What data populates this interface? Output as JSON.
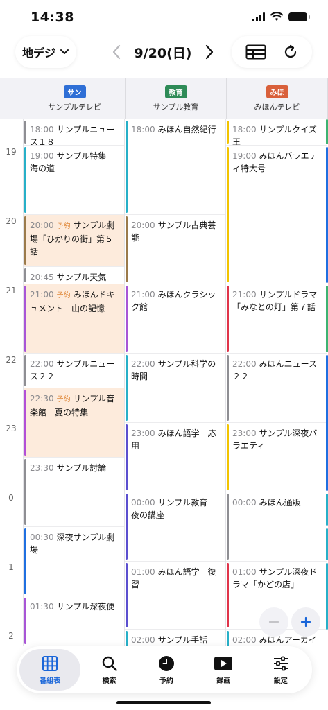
{
  "status_bar": {
    "time": "14:38"
  },
  "toolbar": {
    "channel_type": "地デジ",
    "date": "9/20(日)"
  },
  "channels": [
    {
      "badge": "サン",
      "badge_color": "#2f6fd6",
      "name": "サンプルテレビ"
    },
    {
      "badge": "教育",
      "badge_color": "#2e8b57",
      "name": "サンプル教育"
    },
    {
      "badge": "みほ",
      "badge_color": "#d9603b",
      "name": "みほんテレビ"
    }
  ],
  "hours": [
    "19",
    "20",
    "21",
    "22",
    "23",
    "0",
    "1",
    "2"
  ],
  "reserved_label": "予約",
  "programs": {
    "col1": [
      {
        "time": "18:00",
        "title": "サンプルニュース１８"
      },
      {
        "time": "19:00",
        "title": "サンプル特集　海の道"
      },
      {
        "time": "20:00",
        "title": "サンプル劇場「ひかりの街」第５話"
      },
      {
        "time": "20:45",
        "title": "サンプル天気"
      },
      {
        "time": "21:00",
        "title": "みほんドキュメント　山の記憶"
      },
      {
        "time": "22:00",
        "title": "サンプルニュース２２"
      },
      {
        "time": "22:30",
        "title": "サンプル音楽館　夏の特集"
      },
      {
        "time": "23:30",
        "title": "サンプル討論"
      },
      {
        "time": "00:30",
        "title": "深夜サンプル劇場"
      },
      {
        "time": "01:30",
        "title": "サンプル深夜便"
      }
    ],
    "col2": [
      {
        "time": "18:00",
        "title": "みほん自然紀行"
      },
      {
        "time": "20:00",
        "title": "サンプル古典芸能"
      },
      {
        "time": "21:00",
        "title": "みほんクラシック館"
      },
      {
        "time": "22:00",
        "title": "サンプル科学の時間"
      },
      {
        "time": "23:00",
        "title": "みほん語学　応用"
      },
      {
        "time": "00:00",
        "title": "サンプル教育　夜の講座"
      },
      {
        "time": "01:00",
        "title": "みほん語学　復習"
      },
      {
        "time": "02:00",
        "title": "サンプル手話"
      }
    ],
    "col3": [
      {
        "time": "18:00",
        "title": "サンプルクイズ王"
      },
      {
        "time": "19:00",
        "title": "みほんバラエティ特大号"
      },
      {
        "time": "21:00",
        "title": "サンプルドラマ「みなとの灯」第７話"
      },
      {
        "time": "22:00",
        "title": "みほんニュース２２"
      },
      {
        "time": "23:00",
        "title": "サンプル深夜バラエティ"
      },
      {
        "time": "00:00",
        "title": "みほん通販"
      },
      {
        "time": "01:00",
        "title": "サンプル深夜ドラマ「かどの店」"
      },
      {
        "time": "02:00",
        "title": "みほんアーカイブ"
      }
    ]
  },
  "tabs": [
    {
      "label": "番組表",
      "icon": "grid-icon"
    },
    {
      "label": "検索",
      "icon": "search-icon"
    },
    {
      "label": "予約",
      "icon": "clock-icon"
    },
    {
      "label": "録画",
      "icon": "play-icon"
    },
    {
      "label": "設定",
      "icon": "sliders-icon"
    }
  ]
}
